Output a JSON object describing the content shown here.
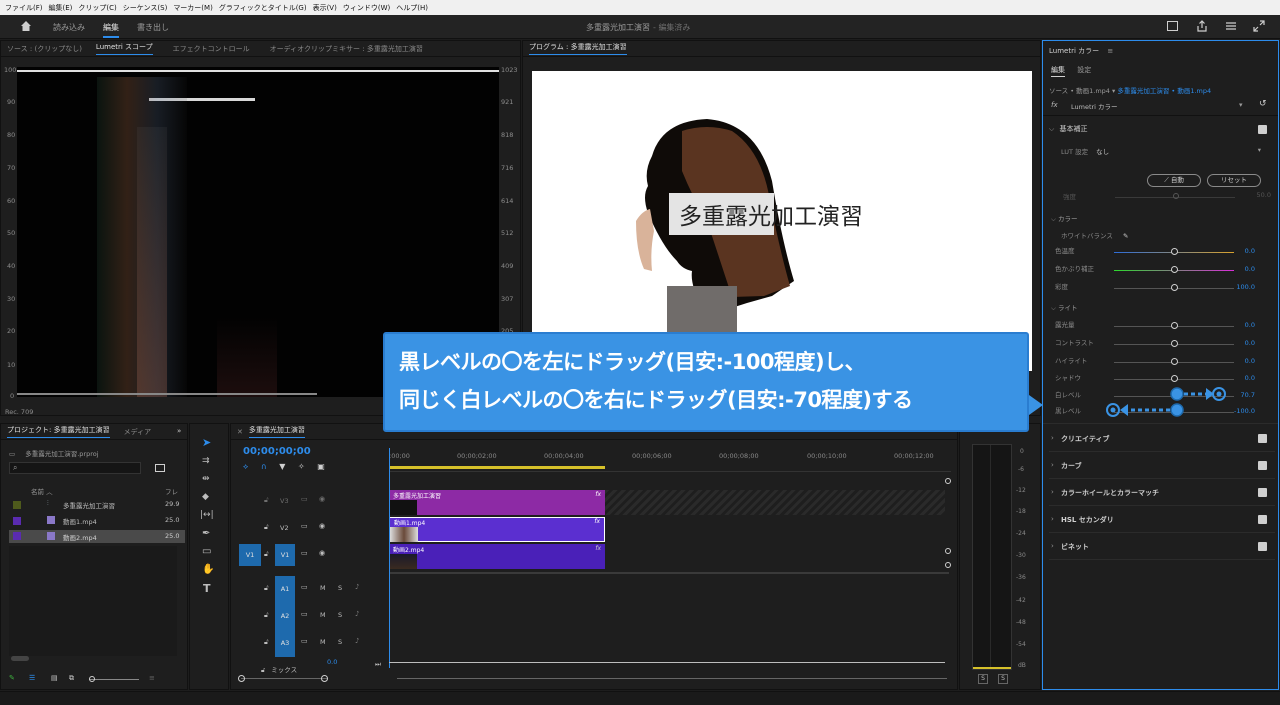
{
  "menu": [
    "ファイル(F)",
    "編集(E)",
    "クリップ(C)",
    "シーケンス(S)",
    "マーカー(M)",
    "グラフィックとタイトル(G)",
    "表示(V)",
    "ウィンドウ(W)",
    "ヘルプ(H)"
  ],
  "header": {
    "tabs": [
      "読み込み",
      "編集",
      "書き出し"
    ],
    "active_tab": "編集",
    "project_title": "多重露光加工演習",
    "save_status": "編集済み"
  },
  "source_panel": {
    "tabs": [
      "ソース : (クリップなし)",
      "Lumetri スコープ",
      "エフェクトコントロール",
      "オーディオクリップミキサー : 多重露光加工演習"
    ],
    "scope_left_labels": [
      "100",
      "90",
      "80",
      "70",
      "60",
      "50",
      "40",
      "30",
      "20",
      "10",
      "0"
    ],
    "scope_right_labels": [
      "1023",
      "921",
      "818",
      "716",
      "614",
      "512",
      "409",
      "307",
      "205",
      "102",
      "0"
    ],
    "footer_text": "Rec. 709"
  },
  "program_panel": {
    "tab": "プログラム : 多重露光加工演習",
    "overlay_title": "多重露光加工演習"
  },
  "callout": {
    "line1": "黒レベルの〇を左にドラッグ(目安:-100程度)し、",
    "line2": "同じく白レベルの〇を右にドラッグ(目安:-70程度)する"
  },
  "project_panel": {
    "tab": "プロジェクト: 多重露光加工演習",
    "tab2": "メディア",
    "file_name": "多重露光加工演習.prproj",
    "col_name": "名前",
    "col_rate": "フレ",
    "items": [
      {
        "name": "多重露光加工演習",
        "rate": "29.9",
        "color": "#4e5a1c"
      },
      {
        "name": "動画1.mp4",
        "rate": "25.0",
        "color": "#5a2bb0"
      },
      {
        "name": "動画2.mp4",
        "rate": "25.0",
        "color": "#5a2bb0"
      }
    ]
  },
  "timeline": {
    "tab": "多重露光加工演習",
    "timecode": "00;00;00;00",
    "ruler": [
      ";00;00",
      "00;00;02;00",
      "00;00;04;00",
      "00;00;06;00",
      "00;00;08;00",
      "00;00;10;00",
      "00;00;12;00"
    ],
    "tracks": [
      "V3",
      "V2",
      "V1",
      "A1",
      "A2",
      "A3"
    ],
    "src_v": "V1",
    "mix_label": "ミックス",
    "mix_value": "0.0",
    "clips": [
      {
        "track": "V3",
        "name": "多重露光加工演習",
        "color": "#8d2aa5"
      },
      {
        "track": "V2",
        "name": "動画1.mp4",
        "color": "#5b2fd0"
      },
      {
        "track": "V1",
        "name": "動画2.mp4",
        "color": "#4a20b8"
      }
    ]
  },
  "audio_meter": {
    "ticks": [
      "0",
      "-6",
      "-12",
      "-18",
      "-24",
      "-30",
      "-36",
      "-42",
      "-48",
      "-54",
      "dB"
    ],
    "solo": "S"
  },
  "lumetri": {
    "panel_title": "Lumetri カラー",
    "tabs": [
      "編集",
      "設定"
    ],
    "source_label": "ソース • 動画1.mp4",
    "seq_label": "多重露光加工演習 • 動画1.mp4",
    "effect_name": "Lumetri カラー",
    "basic": {
      "title": "基本補正",
      "lut_label": "LUT 設定",
      "lut_value": "なし",
      "auto_btn": "自動",
      "reset_btn": "リセット",
      "intensity_label": "強度",
      "intensity_value": "50.0",
      "color_title": "カラー",
      "wb_label": "ホワイトバランス",
      "light_title": "ライト",
      "sliders": [
        {
          "label": "色温度",
          "value": "0.0",
          "level": 0.5
        },
        {
          "label": "色かぶり補正",
          "value": "0.0",
          "level": 0.5
        },
        {
          "label": "彩度",
          "value": "100.0",
          "level": 0.5
        },
        {
          "label": "露光量",
          "value": "0.0",
          "level": 0.5
        },
        {
          "label": "コントラスト",
          "value": "0.0",
          "level": 0.5
        },
        {
          "label": "ハイライト",
          "value": "0.0",
          "level": 0.5
        },
        {
          "label": "シャドウ",
          "value": "0.0",
          "level": 0.5
        },
        {
          "label": "白レベル",
          "value": "70.7",
          "level": 0.5
        },
        {
          "label": "黒レベル",
          "value": "-100.0",
          "level": 0.5
        }
      ]
    },
    "sections": [
      "クリエイティブ",
      "カーブ",
      "カラーホイールとカラーマッチ",
      "HSL セカンダリ",
      "ビネット"
    ]
  }
}
